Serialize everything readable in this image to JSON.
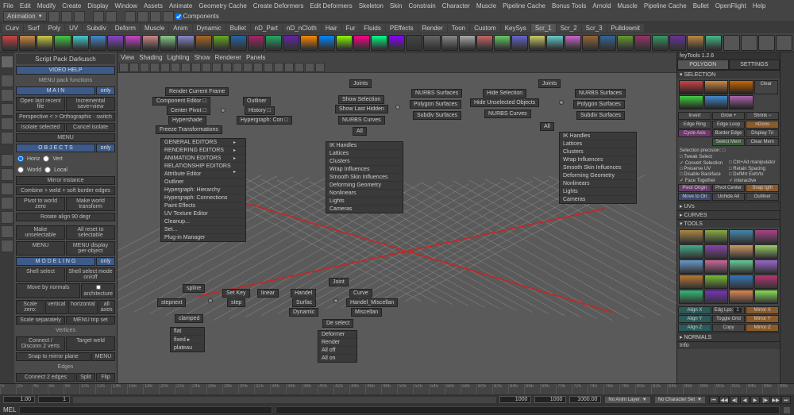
{
  "menubar": [
    "File",
    "Edit",
    "Modify",
    "Create",
    "Display",
    "Window",
    "Assets",
    "Animate",
    "Geometry Cache",
    "Create Deformers",
    "Edit Deformers",
    "Skeleton",
    "Skin",
    "Constrain",
    "Character",
    "Muscle",
    "Pipeline Cache",
    "Bonus Tools",
    "Arnold",
    "Muscle",
    "Pipeline Cache",
    "Bullet",
    "OpenFlight",
    "Help"
  ],
  "mode_dropdown": "Animation",
  "status_components": "Components",
  "shelf_tabs": [
    "Curv",
    "Surf",
    "Poly",
    "UV",
    "Subdiv",
    "Deform",
    "Muscle",
    "Anim",
    "Dynamic",
    "Bullet",
    "nD_Part",
    "nD_nCloth",
    "Hair",
    "Fur",
    "Fluids",
    "PEffects",
    "Render",
    "Toon",
    "Custom",
    "KeySys",
    "Scr_1",
    "Scr_2",
    "Scr_3",
    "Pulldownit"
  ],
  "left": {
    "title": "Script Pack Darkusch",
    "video_help": "VIDEO HELP",
    "menu_pack": "MENU pack functions",
    "main": "M A I N",
    "only": "only",
    "open_last": "Open last recent file",
    "inc_save": "Incremental save+view",
    "persp": "Perspective < > Orthographic · switch",
    "isolate": "Isolate selected",
    "cancel_iso": "Cancel isolate",
    "menu": "MENU",
    "objects": "O B J E C T S",
    "horiz": "Horiz",
    "vert": "Vert",
    "world": "World",
    "local": "Local",
    "mirror": "Mirror instance",
    "combine": "Combine + weld + soft border edges",
    "pivot_world": "Pivot to world zero",
    "make_world": "Make world transform",
    "rotate90": "Rotate align 90 degr",
    "unselect": "Make unselectable",
    "reset_sel": "All reset to selectable",
    "menu2": "MENU",
    "menu_display": "MENU display per-object",
    "modeling": "M O D E L I N G",
    "shell_sel": "Shell select",
    "shell_mode": "Shell select mode on/off",
    "move_norm": "Move by normals",
    "arch": "architecture",
    "scale_zero": "Scale zero:",
    "vertical": "vertical",
    "horizontal": "horizontal",
    "all_axes": "all axes",
    "scale_sep": "Scale separately",
    "menu_trip": "MENU trip set",
    "vertices": "Vertices",
    "connect2v": "Connect / Disconn 2 verts",
    "target_weld": "Target weld",
    "snap_mirror": "Snap to mirror plane",
    "edges": "Edges",
    "connect2e": "Connect 2 edges",
    "split": "Split",
    "flip": "Flip"
  },
  "vp_menus": [
    "View",
    "Shading",
    "Lighting",
    "Show",
    "Renderer",
    "Panels"
  ],
  "mm_render": "Render Current Frame",
  "mm_comp_editor": "Component Editor",
  "mm_center_pivot": "Center Pivot",
  "mm_hypershade": "Hypershade",
  "mm_freeze": "Freeze Transformations",
  "mm_outliner": "Outliner",
  "mm_history": "History",
  "mm_hypergraph": "Hypergraph: Con",
  "mm_editors": [
    "GENERAL EDITORS",
    "RENDERING EDITORS",
    "ANIMATION EDITORS",
    "RELATIONSHIP EDITORS",
    "Attribute Editor",
    "Outliner",
    "Hypergraph: Hierarchy",
    "Hypergraph: Connections",
    "Paint Effects",
    "UV Texture Editor",
    "Cleanup...",
    "Set...",
    "Plug-in Manager"
  ],
  "mm_joints": "Joints",
  "mm_show_sel": "Show Selection",
  "mm_show_last": "Show Last Hidden",
  "mm_nurbs_curves": "NURBS Curves",
  "mm_nurbs_surf": "NURBS Surfaces",
  "mm_poly_surf": "Polygon Surfaces",
  "mm_subdiv_surf": "Subdiv Surfaces",
  "mm_all": "All",
  "mm_hide_sel": "Hide Selection",
  "mm_hide_unsel": "Hide Unselected Objects",
  "mm_objlist": [
    "IK Handles",
    "Lattices",
    "Clusters",
    "Wrap Influences",
    "Smooth Skin Influences",
    "Deforming Geometry",
    "Nonlinears",
    "Lights",
    "Cameras"
  ],
  "mm_objlist2": [
    "IK Handles",
    "Lattices",
    "Clusters",
    "Wrap Influences",
    "Smooth Skin Influences",
    "Deforming Geometry",
    "Nonlinears",
    "Lights",
    "Cameras"
  ],
  "mm_spline": "spline",
  "mm_stepnext": "stepnext",
  "mm_clamped": "clamped",
  "mm_flat": "flat",
  "mm_fixed": "fixed",
  "mm_plateau": "plateau",
  "mm_setkey": "Set Key",
  "mm_linear": "linear",
  "mm_step": "step",
  "mm_handel": "Handel",
  "mm_surfac": "Surfac",
  "mm_dynamic": "Dynamic",
  "mm_joint": "Joint",
  "mm_curve": "Curve",
  "mm_handel_misc": "Handel_Miscellan",
  "mm_miscellan": "Miscellan",
  "mm_deselect": "De select",
  "mm_allonoff": [
    "Deformer",
    "Render",
    "All off",
    "All on"
  ],
  "right": {
    "title": "feyTools 1.2.6",
    "tab_poly": "POLYGON",
    "tab_settings": "SETTINGS",
    "selection": "SELECTION",
    "clear": "Clear",
    "invert": "Invert",
    "grow": "Grow +",
    "shrink": "Shrink −",
    "edge_ring": "Edge Ring",
    "edge_loop": "Edge Loop",
    "ngons": "nGons",
    "cycle_axis": "Cycle Axis",
    "border_edge": "Border Edge",
    "display_tri": "Display Tri",
    "select_mem": "Select Mem",
    "clear_mem": "Clear Mem",
    "precision": "Selection precision:",
    "tweak": "Tweak Select",
    "convert_sel": "Convert Selection",
    "ctrl_ad": "Ctrl+Ad manipulator",
    "preserve_uv": "Preserve UV",
    "retain_sp": "Retain Spacing",
    "disable_bf": "Disable Backface",
    "defmt": "DefMrt ExitVtx",
    "face_together": "Face Together",
    "interactive": "Interactive",
    "pivot_origin": "Pivot Origin",
    "pivot_center": "Pivot Center",
    "snap_tgth": "Snap tgth",
    "move_ori": "Move to Ori",
    "unhide_all": "Unhide All",
    "outliner": "Outliner",
    "uvs": "UVs",
    "curves": "CURVES",
    "tools": "TOOLS",
    "align_x": "Align X",
    "edge_lps": "Edg Lps:",
    "one": "1",
    "mirror_x": "Mirror X",
    "align_y": "Align Y",
    "toggle_grid": "Toggle Grid",
    "mirror_y": "Mirror Y",
    "align_z": "Align Z",
    "copy": "Copy",
    "mirror_z": "Mirror Z",
    "normals": "NORMALS",
    "info": "Info"
  },
  "time": {
    "ticks": [
      "5",
      "25",
      "45",
      "65",
      "85",
      "105",
      "125",
      "145",
      "165",
      "185",
      "205",
      "225",
      "245",
      "265",
      "285",
      "305",
      "325",
      "345",
      "365",
      "385",
      "405",
      "425",
      "445",
      "465",
      "485",
      "505",
      "525",
      "545",
      "565",
      "585",
      "605",
      "625",
      "645",
      "665",
      "685",
      "705",
      "725",
      "745",
      "765",
      "785",
      "805",
      "825",
      "845",
      "865",
      "885",
      "905",
      "925",
      "945",
      "965",
      "985"
    ],
    "start": "1.00",
    "start2": "1",
    "end": "1000",
    "end2": "1000",
    "end3": "1000.00",
    "anim_layer": "No Anim Layer",
    "char_set": "No Character Set"
  },
  "cmd_label": "MEL",
  "swatch_colors": [
    "#c44",
    "#c84",
    "#c60",
    "#4c4",
    "#48c",
    "#a6a"
  ]
}
